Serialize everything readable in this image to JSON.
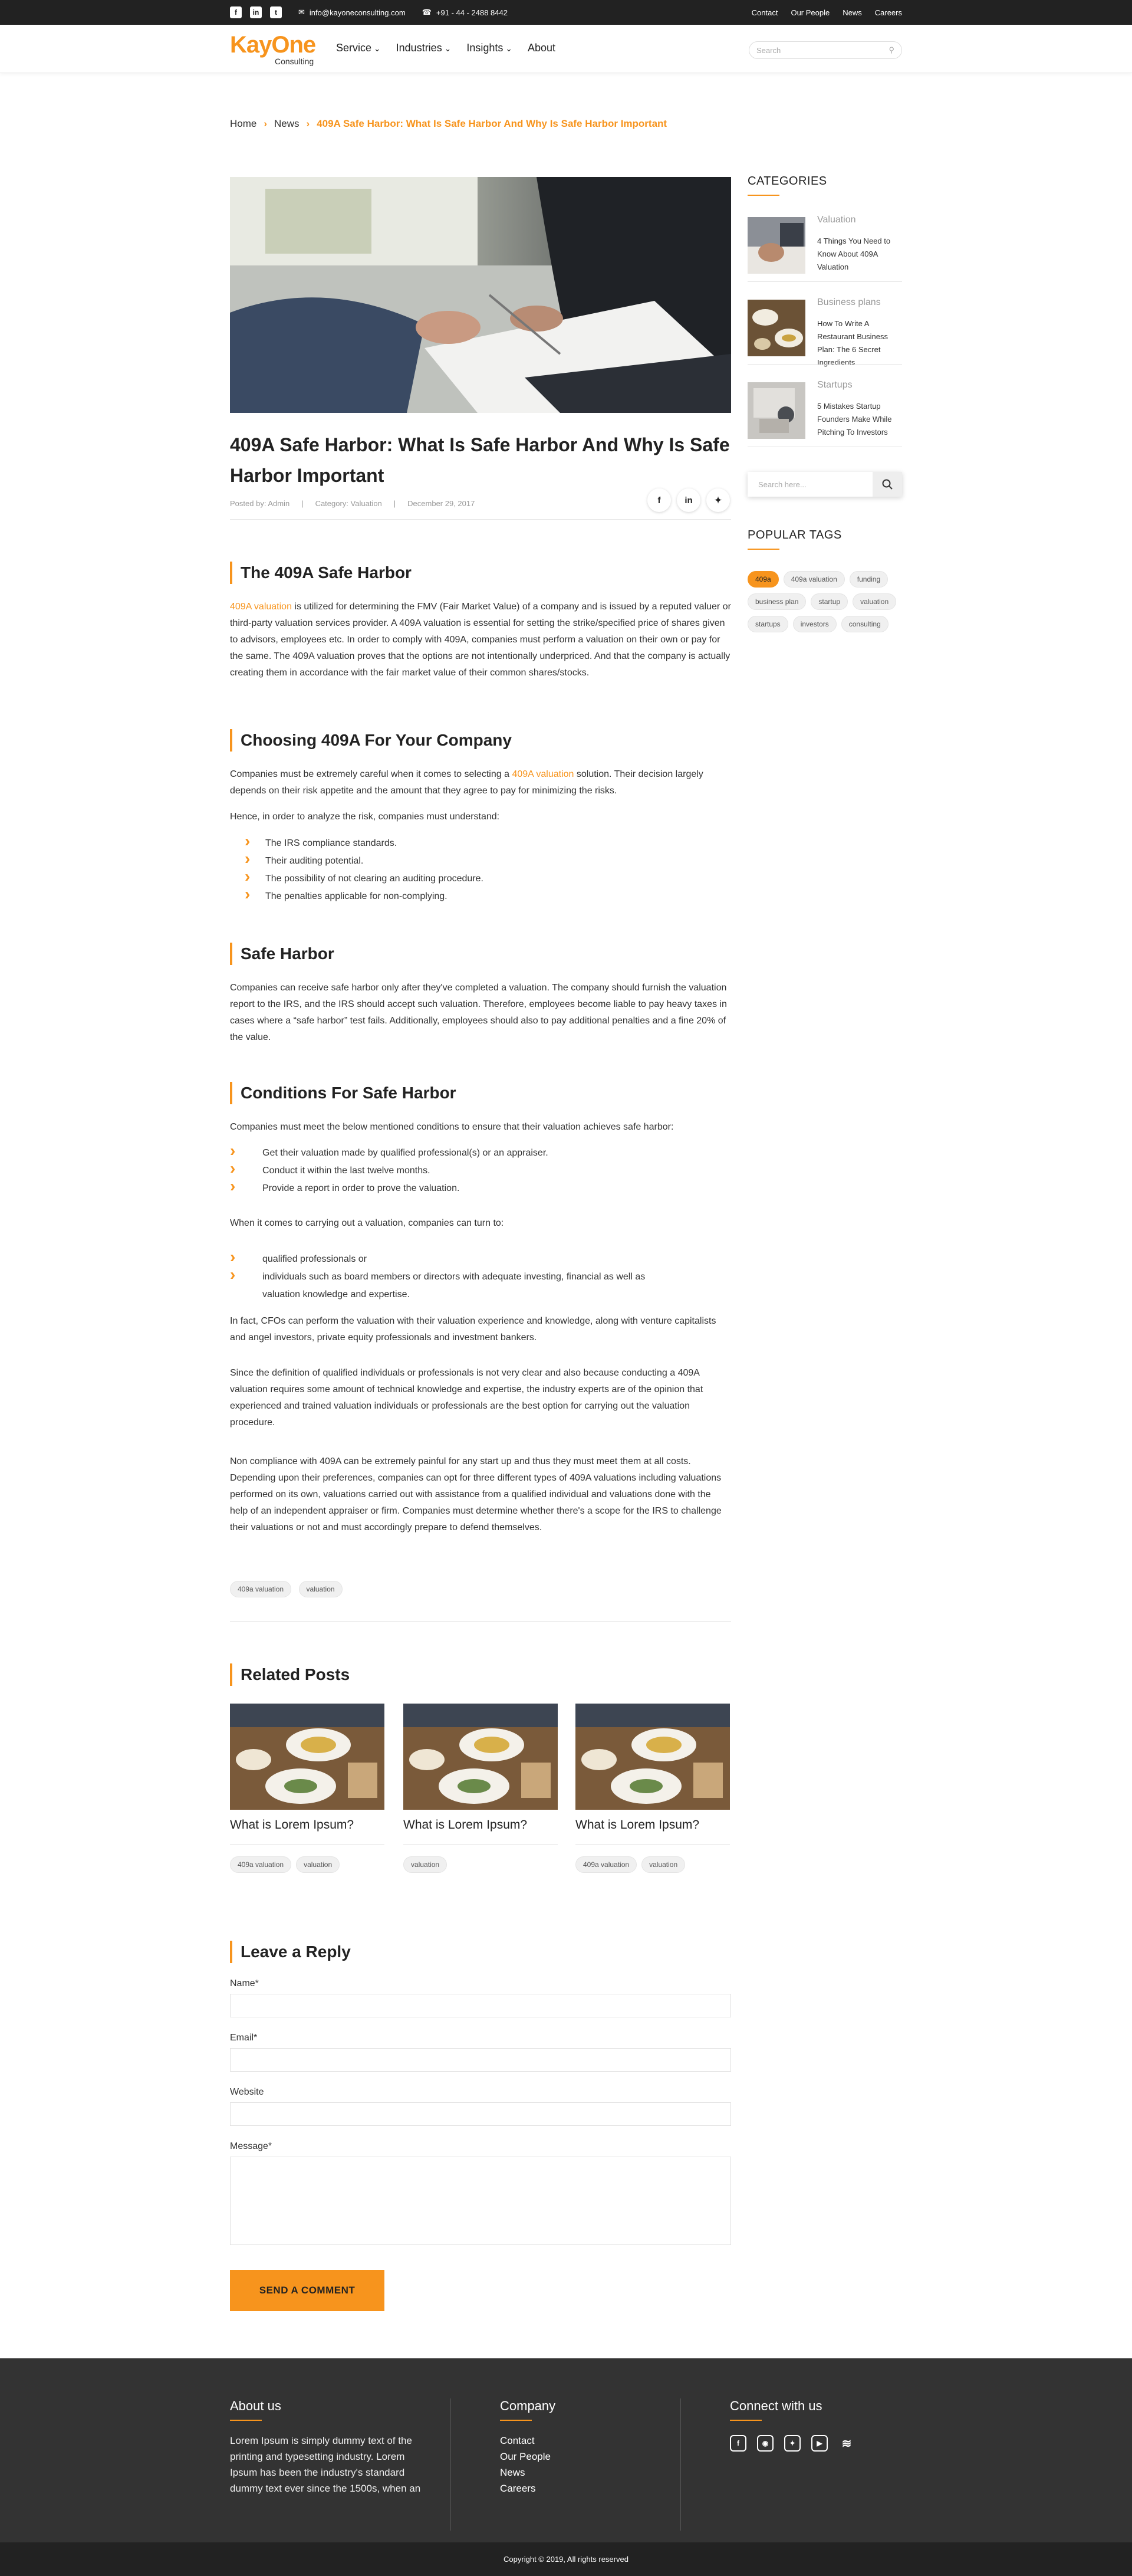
{
  "topbar": {
    "social": [
      "f",
      "in",
      "t"
    ],
    "email": "info@kayoneconsulting.com",
    "phone": "+91 - 44 - 2488 8442",
    "links": [
      "Contact",
      "Our People",
      "News",
      "Careers"
    ]
  },
  "header": {
    "logo_main": "KayOne",
    "logo_sub": "Consulting",
    "nav": [
      "Service",
      "Industries",
      "Insights",
      "About"
    ],
    "search_placeholder": "Search"
  },
  "breadcrumb": {
    "home": "Home",
    "news": "News",
    "current": "409A Safe Harbor: What Is Safe Harbor And Why Is Safe Harbor Important"
  },
  "post": {
    "title": "409A Safe Harbor: What Is Safe Harbor And Why Is Safe Harbor Important",
    "posted_by": "Posted by:  Admin",
    "category": "Category:  Valuation",
    "date": "December 29, 2017",
    "s1_title": "The 409A Safe Harbor",
    "s1_link": "409A valuation",
    "s1_text": " is utilized for determining the FMV (Fair Market Value) of a company and is issued by a reputed valuer or third-party valuation services provider. A 409A valuation is essential for setting the strike/specified price of shares given to advisors, employees etc. In order to comply with 409A, companies must perform a valuation on their own or pay for the same. The 409A valuation proves that the options are not intentionally underpriced. And that the company is actually creating them in accordance with the fair market value of their common shares/stocks.",
    "s2_title": "Choosing 409A For Your Company",
    "s2_a": "Companies must be extremely careful when it comes to selecting a ",
    "s2_link": "409A valuation",
    "s2_b": " solution. Their decision largely depends on their risk appetite and the amount that they agree to pay for minimizing the risks.",
    "s2_c": "Hence, in order to analyze the risk, companies must understand:",
    "s2_list": [
      "The IRS compliance standards.",
      "Their auditing potential.",
      "The possibility of not clearing an auditing procedure.",
      "The penalties applicable for non-complying."
    ],
    "s3_title": "Safe Harbor",
    "s3_text": "Companies can receive safe harbor only after they've completed a valuation. The company should furnish the valuation report to the IRS, and the IRS should accept such valuation. Therefore, employees become liable to pay heavy taxes in cases where a “safe harbor” test fails. Additionally, employees should also to pay additional penalties and a fine 20% of the value.",
    "s4_title": "Conditions For Safe Harbor",
    "s4_a": "Companies must meet the below mentioned conditions to ensure that their valuation achieves safe harbor:",
    "s4_list1": [
      "Get their valuation made by qualified professional(s) or an appraiser.",
      "Conduct it within the last twelve months.",
      "Provide a report in order to prove the valuation."
    ],
    "s4_b": "When it comes to carrying out a valuation, companies can turn to:",
    "s4_list2": [
      "qualified professionals or",
      "individuals such as board members or directors with adequate investing, financial as well as valuation knowledge and expertise."
    ],
    "s4_c": "In fact, CFOs can perform the valuation with their valuation experience and knowledge, along with venture capitalists and angel investors, private equity professionals and investment bankers.",
    "s4_d": "Since the definition of qualified individuals or professionals is not very clear and also because conducting a 409A valuation requires some amount of technical knowledge and expertise, the industry experts are of the opinion that experienced and trained valuation individuals or professionals are the best option for carrying out the valuation procedure.",
    "s4_e": "Non compliance with 409A can be extremely painful for any start up and thus they must meet them at all costs. Depending upon their preferences, companies can opt for three different types of 409A valuations including valuations performed on its own, valuations carried out with assistance from a qualified individual and valuations done with the help of an independent appraiser or firm. Companies must determine whether there's a scope for the IRS to challenge their valuations or not and must accordingly prepare to defend themselves.",
    "tags": [
      "409a valuation",
      "valuation"
    ]
  },
  "related": {
    "title": "Related Posts",
    "items": [
      {
        "title": "What is Lorem Ipsum?",
        "tags": [
          "409a valuation",
          "valuation"
        ]
      },
      {
        "title": "What is Lorem Ipsum?",
        "tags": [
          "valuation"
        ]
      },
      {
        "title": "What is Lorem Ipsum?",
        "tags": [
          "409a valuation",
          "valuation"
        ]
      }
    ]
  },
  "reply": {
    "title": "Leave a Reply",
    "name": "Name*",
    "email": "Email*",
    "website": "Website",
    "message": "Message*",
    "button": "SEND A COMMENT"
  },
  "sidebar": {
    "categories_title": "CATEGORIES",
    "categories": [
      {
        "name": "Valuation",
        "desc": "4 Things You Need to Know About 409A Valuation"
      },
      {
        "name": "Business plans",
        "desc": "How To Write A Restaurant Business Plan: The 6 Secret Ingredients"
      },
      {
        "name": "Startups",
        "desc": "5 Mistakes Startup Founders Make While Pitching To Investors"
      }
    ],
    "search_placeholder": "Search here...",
    "tags_title": "POPULAR TAGS",
    "tags": [
      "409a",
      "409a valuation",
      "funding",
      "business plan",
      "startup",
      "valuation",
      "startups",
      "investors",
      "consulting"
    ]
  },
  "footer": {
    "about_title": "About us",
    "about_text": "Lorem Ipsum is simply dummy text of the printing and typesetting industry. Lorem Ipsum has been the industry's standard dummy text ever since the 1500s, when an",
    "company_title": "Company",
    "company_links": [
      "Contact",
      "Our People",
      "News",
      "Careers"
    ],
    "connect_title": "Connect with us",
    "copyright": "Copyright © 2019, All rights reserved"
  },
  "colors": {
    "accent": "#f7941d",
    "dark": "#222222",
    "footer": "#333333"
  }
}
